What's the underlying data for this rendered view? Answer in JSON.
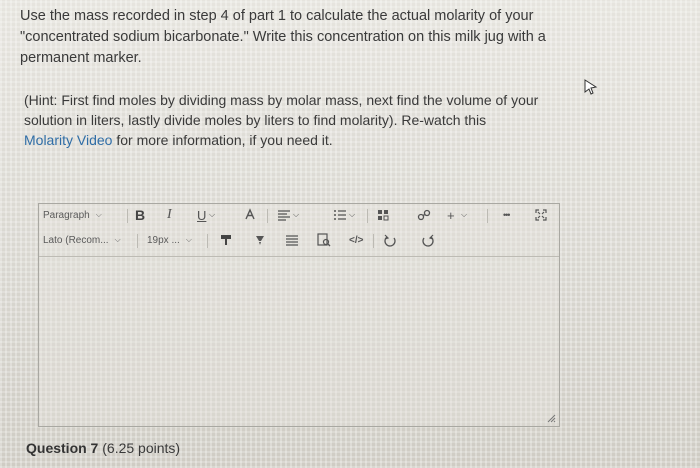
{
  "instructions": {
    "line1": "Use the mass recorded in step 4 of part 1 to calculate the actual molarity of your",
    "line2": "\"concentrated sodium bicarbonate.\" Write this concentration on this milk jug with a",
    "line3": "permanent marker."
  },
  "hint": {
    "line1": "(Hint: First find moles by dividing mass by molar mass, next find the volume of your",
    "line2": "solution in liters, lastly divide moles by liters to find molarity). Re-watch this",
    "link_text": "Molarity Video",
    "line3_rest": " for more information, if you need it."
  },
  "editor": {
    "toolbar": {
      "paragraph_label": "Paragraph",
      "font_label": "Lato (Recom...",
      "size_label": "19px ...",
      "bold": "B",
      "italic": "I",
      "underline": "U",
      "plus": "+",
      "more": "•••"
    }
  },
  "question": {
    "label": "Question 7",
    "points": " (6.25 points)"
  },
  "colors": {
    "text": "#3a3a3a",
    "link": "#2f6da6",
    "border": "#a9a8a2"
  },
  "icons": [
    "cursor-icon",
    "chevron-down-icon",
    "text-color-icon",
    "align-icon",
    "list-icon",
    "media-icon",
    "link-icon",
    "plus-icon",
    "more-icon",
    "fullscreen-icon",
    "paint-format-icon",
    "highlighter-icon",
    "table-icon",
    "find-replace-icon",
    "code-icon",
    "undo-icon",
    "redo-icon",
    "resize-icon"
  ]
}
